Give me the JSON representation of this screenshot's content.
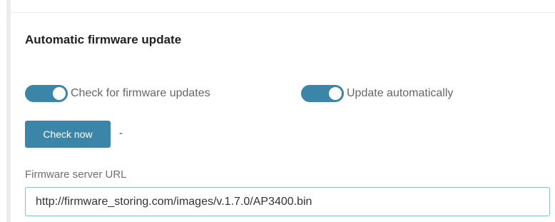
{
  "section": {
    "title": "Automatic firmware update"
  },
  "toggles": {
    "check_updates": {
      "label": "Check for firmware updates",
      "enabled": true
    },
    "update_auto": {
      "label": "Update automatically",
      "enabled": true
    }
  },
  "check": {
    "button_label": "Check now",
    "status": "-"
  },
  "server_url": {
    "label": "Firmware server URL",
    "value": "http://firmware_storing.com/images/v.1.7.0/AP3400.bin"
  },
  "colors": {
    "accent": "#3b86a8",
    "input_border": "#8cbad0"
  }
}
